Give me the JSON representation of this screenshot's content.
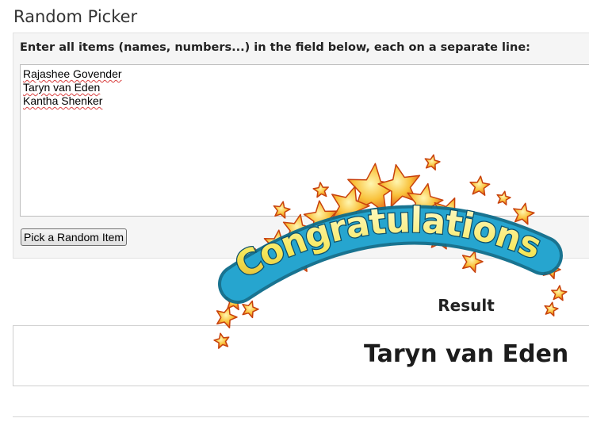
{
  "page": {
    "title": "Random Picker"
  },
  "picker": {
    "instructions": "Enter all items (names, numbers...) in the field below, each on a separate line:",
    "items": [
      "Rajashee Govender",
      "Taryn van Eden",
      "Kantha Shenker"
    ],
    "pick_button_label": "Pick a Random Item"
  },
  "celebration": {
    "banner_text": "Congratulations",
    "icon": "stars-burst-icon",
    "colors": {
      "star_fill": "#f7a21b",
      "star_edge": "#c8410c",
      "banner_fill": "#f9ec6a",
      "banner_outline": "#0d6b8a"
    }
  },
  "result": {
    "heading": "Result",
    "value": "Taryn van Eden"
  }
}
